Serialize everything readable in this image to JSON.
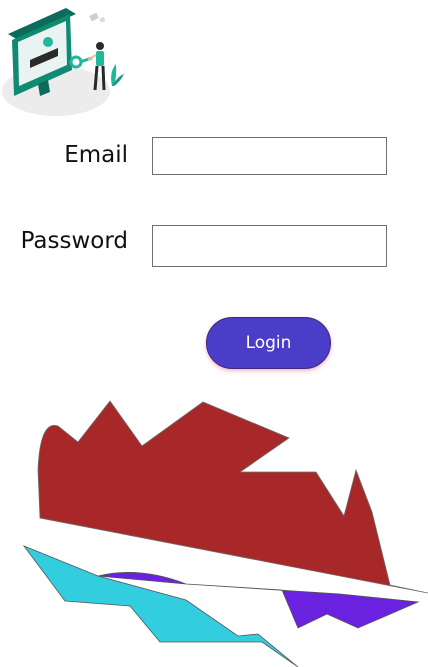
{
  "form": {
    "email_label": "Email",
    "email_value": "",
    "password_label": "Password",
    "password_value": "",
    "login_label": "Login"
  },
  "illustration": {
    "icon": "login-illustration-icon",
    "accent": "#1fb89a"
  },
  "colors": {
    "button_bg": "#4a3ec8",
    "button_text": "#ffffff",
    "shape_red": "#a8282a",
    "shape_cyan": "#33cde0",
    "shape_purple": "#6a21e0"
  }
}
